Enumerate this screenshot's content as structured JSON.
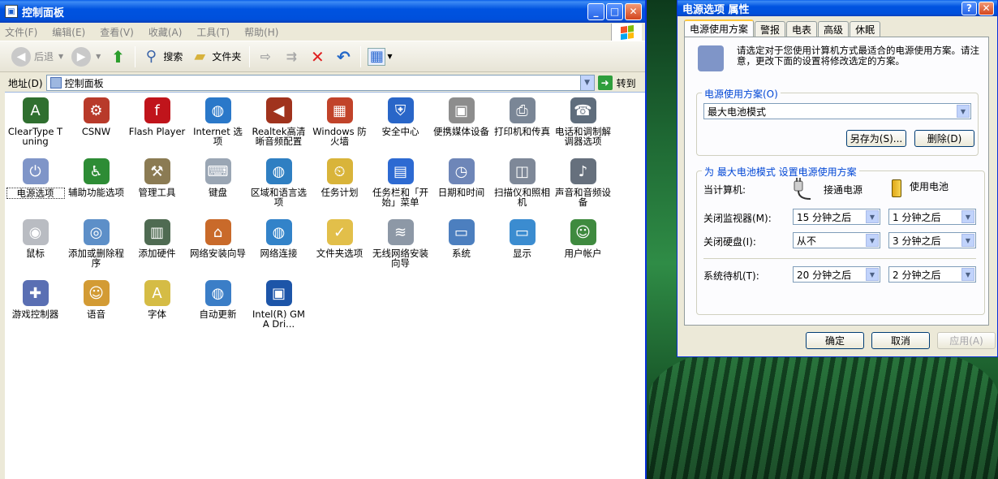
{
  "explorer": {
    "title": "控制面板",
    "menu": [
      "文件(F)",
      "编辑(E)",
      "查看(V)",
      "收藏(A)",
      "工具(T)",
      "帮助(H)"
    ],
    "toolbar": {
      "back": "后退",
      "search": "搜索",
      "folders": "文件夹"
    },
    "address": {
      "label": "地址(D)",
      "value": "控制面板",
      "go": "转到"
    },
    "items": [
      {
        "label": "ClearType Tuning",
        "icon": "cleartype-icon",
        "color": "#2f6f2f",
        "glyph": "A"
      },
      {
        "label": "CSNW",
        "icon": "network-client-icon",
        "color": "#b83a2a",
        "glyph": "⚙"
      },
      {
        "label": "Flash Player",
        "icon": "flash-icon",
        "color": "#c0141b",
        "glyph": "f"
      },
      {
        "label": "Internet 选项",
        "icon": "globe-icon",
        "color": "#2a78c9",
        "glyph": "◍"
      },
      {
        "label": "Realtek高清晰音频配置",
        "icon": "speaker-icon",
        "color": "#a0331d",
        "glyph": "◀"
      },
      {
        "label": "Windows 防火墙",
        "icon": "firewall-icon",
        "color": "#c1432a",
        "glyph": "▦"
      },
      {
        "label": "安全中心",
        "icon": "shield-icon",
        "color": "#2966c8",
        "glyph": "⛨"
      },
      {
        "label": "便携媒体设备",
        "icon": "portable-device-icon",
        "color": "#8d8d8d",
        "glyph": "▣"
      },
      {
        "label": "打印机和传真",
        "icon": "printer-icon",
        "color": "#7a8696",
        "glyph": "⎙"
      },
      {
        "label": "电话和调制解调器选项",
        "icon": "phone-icon",
        "color": "#5f6d7c",
        "glyph": "☎"
      },
      {
        "label": "电源选项",
        "icon": "power-plug-icon",
        "color": "#7f95c8",
        "glyph": "⏻"
      },
      {
        "label": "辅助功能选项",
        "icon": "accessibility-icon",
        "color": "#2d8c35",
        "glyph": "♿"
      },
      {
        "label": "管理工具",
        "icon": "admin-tools-icon",
        "color": "#8b7b53",
        "glyph": "⚒"
      },
      {
        "label": "键盘",
        "icon": "keyboard-icon",
        "color": "#9aa6b4",
        "glyph": "⌨"
      },
      {
        "label": "区域和语言选项",
        "icon": "region-globe-icon",
        "color": "#2f7fc2",
        "glyph": "◍"
      },
      {
        "label": "任务计划",
        "icon": "scheduled-tasks-icon",
        "color": "#d9b43a",
        "glyph": "⏲"
      },
      {
        "label": "任务栏和「开始」菜单",
        "icon": "taskbar-icon",
        "color": "#2d6ad2",
        "glyph": "▤"
      },
      {
        "label": "日期和时间",
        "icon": "clock-icon",
        "color": "#6e86b8",
        "glyph": "◷"
      },
      {
        "label": "扫描仪和照相机",
        "icon": "scanner-icon",
        "color": "#7e8898",
        "glyph": "◫"
      },
      {
        "label": "声音和音频设备",
        "icon": "audio-icon",
        "color": "#66707d",
        "glyph": "♪"
      },
      {
        "label": "鼠标",
        "icon": "mouse-icon",
        "color": "#b9bcc2",
        "glyph": "◉"
      },
      {
        "label": "添加或删除程序",
        "icon": "add-remove-programs-icon",
        "color": "#5d8fc8",
        "glyph": "◎"
      },
      {
        "label": "添加硬件",
        "icon": "add-hardware-icon",
        "color": "#4f6b52",
        "glyph": "▥"
      },
      {
        "label": "网络安装向导",
        "icon": "network-wizard-icon",
        "color": "#c96a2a",
        "glyph": "⌂"
      },
      {
        "label": "网络连接",
        "icon": "network-connections-icon",
        "color": "#3383c9",
        "glyph": "◍"
      },
      {
        "label": "文件夹选项",
        "icon": "folder-options-icon",
        "color": "#e2bf4a",
        "glyph": "✓"
      },
      {
        "label": "无线网络安装向导",
        "icon": "wireless-icon",
        "color": "#8d98a6",
        "glyph": "≋"
      },
      {
        "label": "系统",
        "icon": "system-icon",
        "color": "#4c7fbf",
        "glyph": "▭"
      },
      {
        "label": "显示",
        "icon": "display-icon",
        "color": "#3b8cd0",
        "glyph": "▭"
      },
      {
        "label": "用户帐户",
        "icon": "user-accounts-icon",
        "color": "#3f8a3f",
        "glyph": "☺"
      },
      {
        "label": "游戏控制器",
        "icon": "gamepad-icon",
        "color": "#5a6fb3",
        "glyph": "✚"
      },
      {
        "label": "语音",
        "icon": "speech-icon",
        "color": "#d39b34",
        "glyph": "☺"
      },
      {
        "label": "字体",
        "icon": "fonts-icon",
        "color": "#d5bc45",
        "glyph": "A"
      },
      {
        "label": "自动更新",
        "icon": "windows-update-icon",
        "color": "#3b7ec7",
        "glyph": "◍"
      },
      {
        "label": "Intel(R) GMA Dri...",
        "icon": "intel-gma-icon",
        "color": "#1d55a8",
        "glyph": "▣"
      }
    ]
  },
  "dialog": {
    "title": "电源选项 属性",
    "tabs": [
      "电源使用方案",
      "警报",
      "电表",
      "高级",
      "休眠"
    ],
    "intro": "请选定对于您使用计算机方式最适合的电源使用方案。请注意，更改下面的设置将修改选定的方案。",
    "scheme_group_title": "电源使用方案(O)",
    "scheme_value": "最大电池模式",
    "save_as": "另存为(S)...",
    "delete": "删除(D)",
    "settings_group_title": "为 最大电池模式 设置电源使用方案",
    "when_computer": "当计算机:",
    "plugged_in": "接通电源",
    "on_battery": "使用电池",
    "monitor_label": "关闭监视器(M):",
    "monitor_ac": "15 分钟之后",
    "monitor_dc": "1 分钟之后",
    "disk_label": "关闭硬盘(I):",
    "disk_ac": "从不",
    "disk_dc": "3 分钟之后",
    "standby_label": "系统待机(T):",
    "standby_ac": "20 分钟之后",
    "standby_dc": "2 分钟之后",
    "ok": "确定",
    "cancel": "取消",
    "apply": "应用(A)"
  }
}
